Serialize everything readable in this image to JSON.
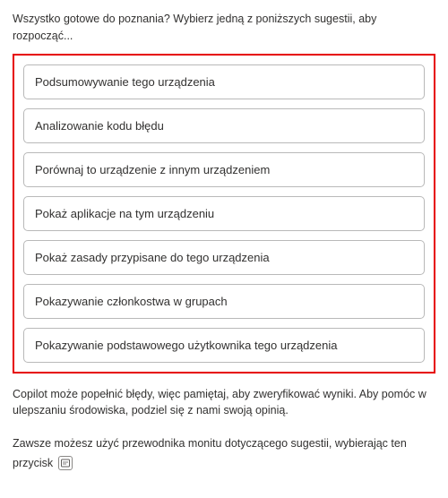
{
  "intro": "Wszystko gotowe do poznania? Wybierz jedną z poniższych sugestii, aby rozpocząć...",
  "suggestions": [
    "Podsumowywanie tego urządzenia",
    "Analizowanie kodu błędu",
    "Porównaj to urządzenie z innym urządzeniem",
    "Pokaż aplikacje na tym urządzeniu",
    "Pokaż zasady przypisane do tego urządzenia",
    "Pokazywanie członkostwa w grupach",
    "Pokazywanie podstawowego użytkownika tego urządzenia"
  ],
  "disclaimer": "Copilot może popełnić błędy, więc pamiętaj, aby zweryfikować wyniki. Aby pomóc w ulepszaniu środowiska, podziel się z nami swoją opinią.",
  "guide": "Zawsze możesz użyć przewodnika monitu dotyczącego sugestii, wybierając ten przycisk"
}
